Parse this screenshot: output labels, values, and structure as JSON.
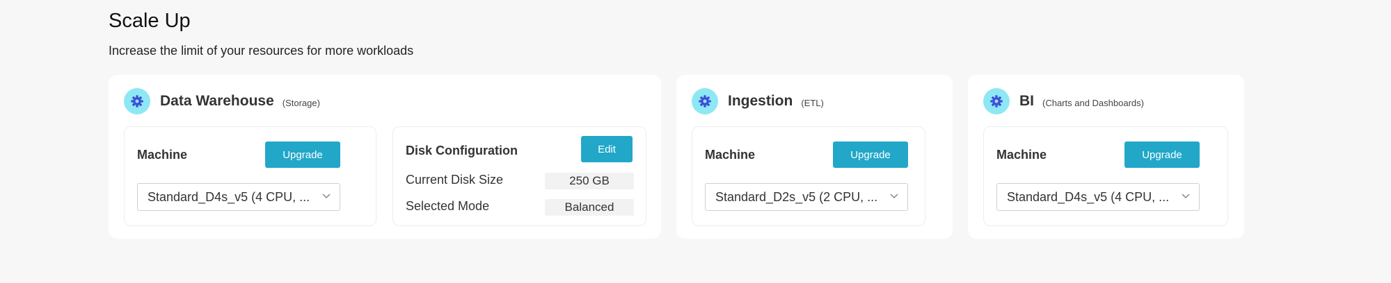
{
  "header": {
    "title": "Scale Up",
    "subtitle": "Increase the limit of your resources for more workloads"
  },
  "cards": {
    "warehouse": {
      "icon": "gear-icon",
      "title": "Data Warehouse",
      "tag": "(Storage)",
      "machine": {
        "label": "Machine",
        "button": "Upgrade",
        "selected": "Standard_D4s_v5 (4 CPU, ..."
      },
      "disk": {
        "label": "Disk Configuration",
        "button": "Edit",
        "rows": [
          {
            "label": "Current Disk Size",
            "value": "250 GB"
          },
          {
            "label": "Selected Mode",
            "value": "Balanced"
          }
        ]
      }
    },
    "ingestion": {
      "icon": "gear-icon",
      "title": "Ingestion",
      "tag": "(ETL)",
      "machine": {
        "label": "Machine",
        "button": "Upgrade",
        "selected": "Standard_D2s_v5 (2 CPU, ..."
      }
    },
    "bi": {
      "icon": "gear-icon",
      "title": "BI",
      "tag": "(Charts and Dashboards)",
      "machine": {
        "label": "Machine",
        "button": "Upgrade",
        "selected": "Standard_D4s_v5 (4 CPU, ..."
      }
    }
  },
  "colors": {
    "accent": "#22a7c9",
    "icon_badge": "#8ee8f4",
    "icon_glyph": "#3d4fd6",
    "background": "#f7f7f7"
  }
}
